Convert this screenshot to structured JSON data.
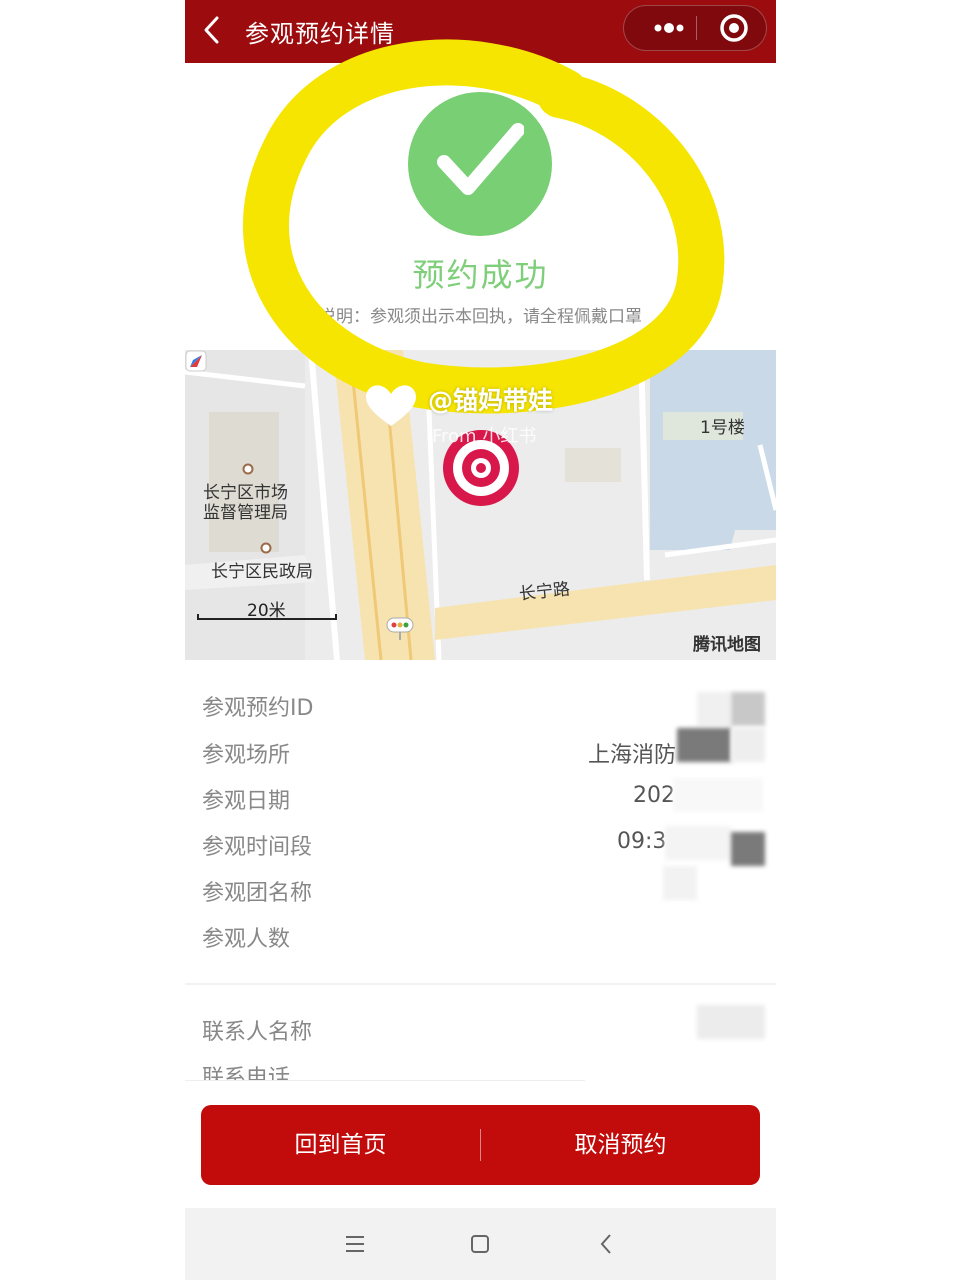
{
  "header": {
    "title": "参观预约详情",
    "back_icon": "chevron-left-icon",
    "more_icon": "more-dots-icon",
    "close_icon": "target-close-icon",
    "color": "#9c0c0f"
  },
  "success": {
    "icon": "check-icon",
    "title": "预约成功",
    "note": "说明：参观须出示本回执，请全程佩戴口罩",
    "color": "#79cf74"
  },
  "map": {
    "labels": {
      "building": "1号楼",
      "poi1_line1": "长宁区市场",
      "poi1_line2": "监督管理局",
      "poi2": "长宁区民政局",
      "road": "长宁路"
    },
    "scale": "20米",
    "provider": "腾讯地图",
    "marker_icon": "location-target-icon"
  },
  "details": {
    "rows": [
      {
        "label": "参观预约ID",
        "value": ""
      },
      {
        "label": "参观场所",
        "value": "上海消防"
      },
      {
        "label": "参观日期",
        "value": "202"
      },
      {
        "label": "参观时间段",
        "value": "09:3"
      },
      {
        "label": "参观团名称",
        "value": ""
      },
      {
        "label": "参观人数",
        "value": ""
      }
    ],
    "contact_rows": [
      {
        "label": "联系人名称",
        "value": ""
      },
      {
        "label": "联系电话",
        "value": ""
      }
    ]
  },
  "actions": {
    "home": "回到首页",
    "cancel": "取消预约",
    "color": "#c20c0c"
  },
  "system_nav": {
    "icons": [
      "menu-icon",
      "home-square-icon",
      "back-icon"
    ]
  },
  "watermark": {
    "handle": "@锚妈带娃",
    "from": "From 小红书"
  }
}
